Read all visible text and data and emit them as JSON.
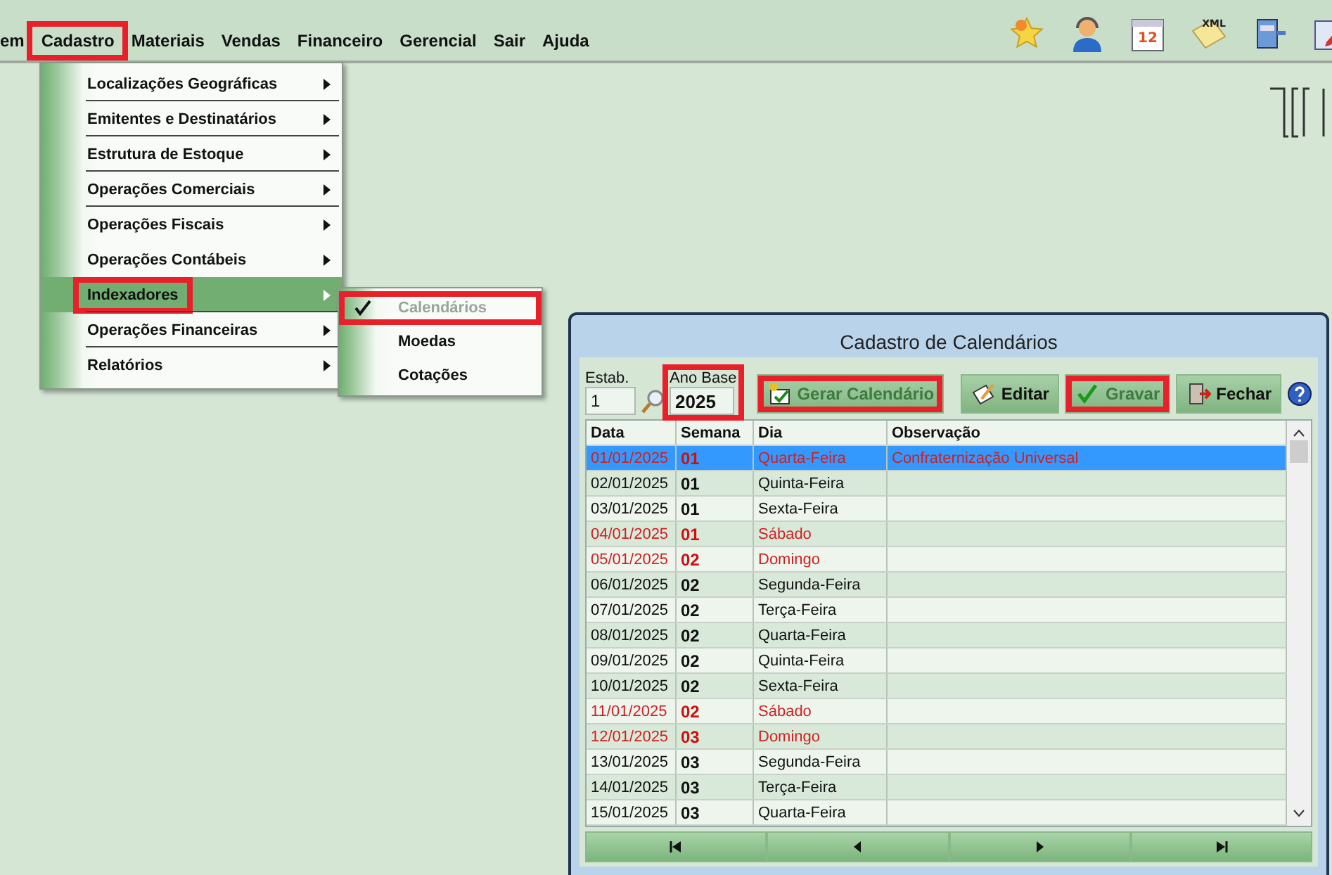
{
  "menubar": {
    "items": [
      {
        "label": "em",
        "highlighted": false
      },
      {
        "label": "Cadastro",
        "highlighted": true
      },
      {
        "label": "Materiais",
        "highlighted": false
      },
      {
        "label": "Vendas",
        "highlighted": false
      },
      {
        "label": "Financeiro",
        "highlighted": false
      },
      {
        "label": "Gerencial",
        "highlighted": false
      },
      {
        "label": "Sair",
        "highlighted": false
      },
      {
        "label": "Ajuda",
        "highlighted": false
      }
    ]
  },
  "toolbar": [
    {
      "kind": "star"
    },
    {
      "kind": "user"
    },
    {
      "kind": "calendar",
      "label": "12"
    },
    {
      "kind": "note",
      "label": "XML"
    },
    {
      "kind": "printer"
    },
    {
      "kind": "edit"
    }
  ],
  "dropdown": {
    "items": [
      {
        "label": "Localizações Geográficas",
        "selected": false,
        "highlighted": false
      },
      {
        "label": "Emitentes e Destinatários",
        "selected": false,
        "highlighted": false
      },
      {
        "label": "Estrutura de Estoque",
        "selected": false,
        "highlighted": false
      },
      {
        "label": "Operações Comerciais",
        "selected": false,
        "highlighted": false
      },
      {
        "label": "Operações Fiscais",
        "selected": false,
        "highlighted": false
      },
      {
        "label": "Operações Contábeis",
        "selected": false,
        "highlighted": false
      },
      {
        "label": "Indexadores",
        "selected": true,
        "highlighted": true
      },
      {
        "label": "Operações Financeiras",
        "selected": false,
        "highlighted": false
      },
      {
        "label": "Relatórios",
        "selected": false,
        "highlighted": false
      }
    ]
  },
  "submenu": {
    "items": [
      {
        "label": "Calendários",
        "checked": true,
        "disabled": true,
        "highlighted": true
      },
      {
        "label": "Moedas",
        "checked": false,
        "disabled": false,
        "highlighted": false
      },
      {
        "label": "Cotações",
        "checked": false,
        "disabled": false,
        "highlighted": false
      }
    ]
  },
  "dialog": {
    "title": "Cadastro de  Calendários",
    "estab": {
      "label": "Estab.",
      "value": "1"
    },
    "ano_base": {
      "label": "Ano Base",
      "value": "2025",
      "highlighted": true
    },
    "buttons": [
      {
        "kind": "generate",
        "label": "Gerar Calendário",
        "disabled": true,
        "highlighted": true
      },
      {
        "kind": "edit",
        "label": "Editar",
        "disabled": false,
        "highlighted": false
      },
      {
        "kind": "save",
        "label": "Gravar",
        "disabled": true,
        "highlighted": true
      },
      {
        "kind": "close",
        "label": "Fechar",
        "disabled": false,
        "highlighted": false
      }
    ],
    "table": {
      "columns": [
        "Data",
        "Semana",
        "Dia",
        "Observação"
      ],
      "rows": [
        {
          "data": "01/01/2025",
          "semana": "01",
          "dia": "Quarta-Feira",
          "observacao": "Confraternização Universal",
          "holiday": true,
          "selected": true
        },
        {
          "data": "02/01/2025",
          "semana": "01",
          "dia": "Quinta-Feira",
          "holiday": false,
          "selected": false
        },
        {
          "data": "03/01/2025",
          "semana": "01",
          "dia": "Sexta-Feira",
          "holiday": false,
          "selected": false
        },
        {
          "data": "04/01/2025",
          "semana": "01",
          "dia": "Sábado",
          "holiday": true,
          "selected": false
        },
        {
          "data": "05/01/2025",
          "semana": "02",
          "dia": "Domingo",
          "holiday": true,
          "selected": false
        },
        {
          "data": "06/01/2025",
          "semana": "02",
          "dia": "Segunda-Feira",
          "holiday": false,
          "selected": false
        },
        {
          "data": "07/01/2025",
          "semana": "02",
          "dia": "Terça-Feira",
          "holiday": false,
          "selected": false
        },
        {
          "data": "08/01/2025",
          "semana": "02",
          "dia": "Quarta-Feira",
          "holiday": false,
          "selected": false
        },
        {
          "data": "09/01/2025",
          "semana": "02",
          "dia": "Quinta-Feira",
          "holiday": false,
          "selected": false
        },
        {
          "data": "10/01/2025",
          "semana": "02",
          "dia": "Sexta-Feira",
          "holiday": false,
          "selected": false
        },
        {
          "data": "11/01/2025",
          "semana": "02",
          "dia": "Sábado",
          "holiday": true,
          "selected": false
        },
        {
          "data": "12/01/2025",
          "semana": "03",
          "dia": "Domingo",
          "holiday": true,
          "selected": false
        },
        {
          "data": "13/01/2025",
          "semana": "03",
          "dia": "Segunda-Feira",
          "holiday": false,
          "selected": false
        },
        {
          "data": "14/01/2025",
          "semana": "03",
          "dia": "Terça-Feira",
          "holiday": false,
          "selected": false
        },
        {
          "data": "15/01/2025",
          "semana": "03",
          "dia": "Quarta-Feira",
          "holiday": false,
          "selected": false
        }
      ]
    },
    "navigator": [
      {
        "kind": "first"
      },
      {
        "kind": "prev"
      },
      {
        "kind": "next"
      },
      {
        "kind": "last"
      }
    ]
  }
}
